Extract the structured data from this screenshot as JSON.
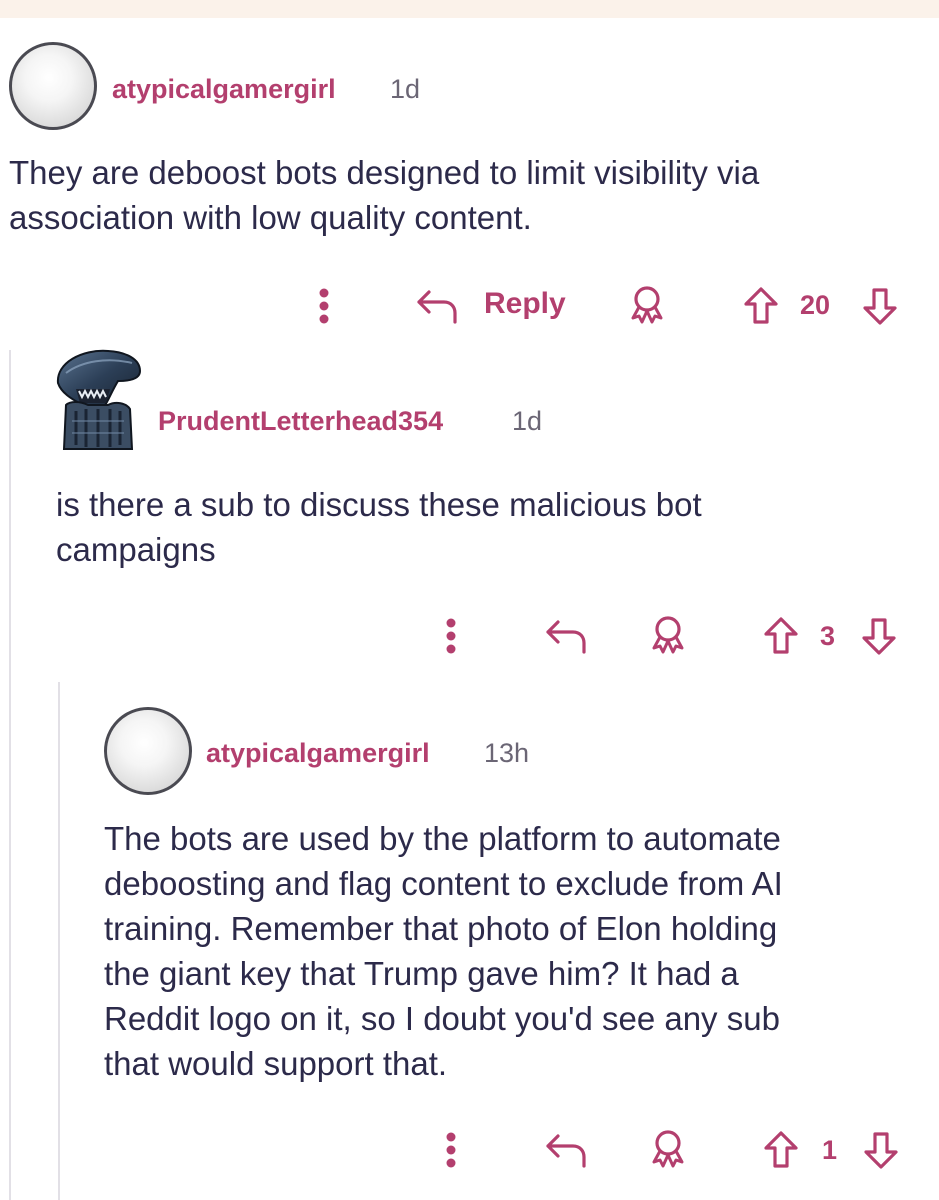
{
  "theme": {
    "accent": "#b33f6e",
    "text": "#2c2a4a",
    "muted": "#6b6675",
    "thread_line": "#e2e0e6",
    "top_strip": "#fbf2ea"
  },
  "comments": [
    {
      "username": "atypicalgamergirl",
      "time": "1d",
      "avatar_icon": "blank-avatar-icon",
      "body_lines": [
        "They are deboost bots designed to limit visibility via",
        "association with low quality content."
      ],
      "reply_label": "Reply",
      "votes": "20"
    },
    {
      "username": "PrudentLetterhead354",
      "time": "1d",
      "avatar_icon": "alien-avatar-icon",
      "body_lines": [
        "is there a sub to discuss these malicious bot",
        "campaigns"
      ],
      "votes": "3"
    },
    {
      "username": "atypicalgamergirl",
      "time": "13h",
      "avatar_icon": "blank-avatar-icon",
      "body_lines": [
        "The bots are used by the platform to automate",
        "deboosting and flag content to exclude from AI",
        "training. Remember that photo of Elon holding",
        "the giant key that Trump gave him? It had a",
        "Reddit logo on it, so I doubt you'd see any sub",
        "that would support that."
      ],
      "votes": "1"
    }
  ],
  "icons": {
    "more": "more-vertical-icon",
    "reply": "reply-arrow-icon",
    "award": "award-icon",
    "upvote": "upvote-arrow-icon",
    "downvote": "downvote-arrow-icon"
  }
}
